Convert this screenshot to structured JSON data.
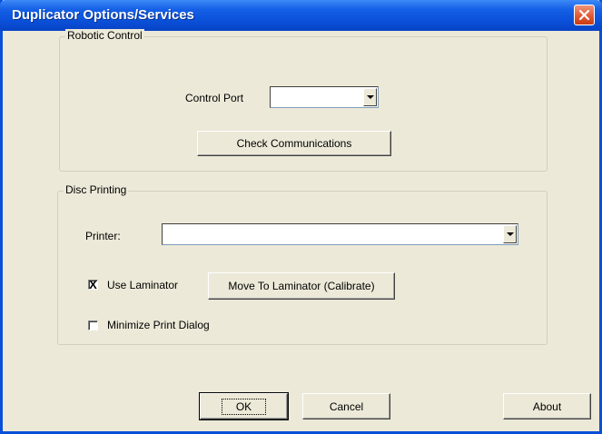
{
  "window": {
    "title": "Duplicator Options/Services"
  },
  "robotic_control": {
    "group_label": "Robotic Control",
    "control_port_label": "Control Port",
    "control_port_value": "",
    "check_communications_label": "Check Communications"
  },
  "disc_printing": {
    "group_label": "Disc Printing",
    "printer_label": "Printer:",
    "printer_value": "",
    "use_laminator_label": "Use Laminator",
    "use_laminator_checked": true,
    "use_laminator_mark": "X",
    "move_to_laminator_label": "Move To Laminator (Calibrate)",
    "minimize_print_dialog_label": "Minimize Print Dialog",
    "minimize_print_dialog_checked": false
  },
  "footer": {
    "ok_label": "OK",
    "cancel_label": "Cancel",
    "about_label": "About"
  },
  "colors": {
    "titlebar": "#0a4fd8",
    "close_button": "#e0562e",
    "dialog_bg": "#ece9d8"
  },
  "icons": {
    "close": "close-icon",
    "dropdown": "chevron-down-icon"
  }
}
